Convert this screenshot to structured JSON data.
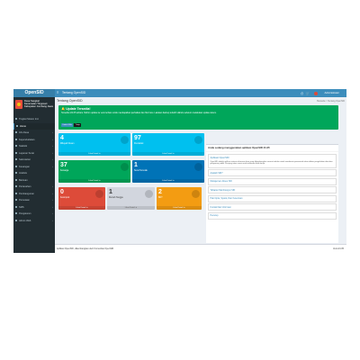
{
  "app": {
    "brand": "OpenSID"
  },
  "header": {
    "title": "Tentang OpenSID",
    "user": "Administrator",
    "breadcrumb": [
      "Beranda",
      "Tentang OpenSID"
    ]
  },
  "page": {
    "heading": "Tentang OpenSID"
  },
  "sidebar": {
    "village_name": "Desa Sangkal\nKecamatan Tlogosari\nKabupaten Jombang Jawa",
    "items": [
      {
        "label": "Tingkat Sistem Ind.",
        "chevron": false
      },
      {
        "label": "Home",
        "chevron": false,
        "active": true
      },
      {
        "label": "Info Desa",
        "chevron": true
      },
      {
        "label": "Kependudukan",
        "chevron": true
      },
      {
        "label": "Statistik",
        "chevron": true
      },
      {
        "label": "Layanan Surat",
        "chevron": true
      },
      {
        "label": "Sekretariat",
        "chevron": true
      },
      {
        "label": "Keuangan",
        "chevron": true
      },
      {
        "label": "Analisis",
        "chevron": false
      },
      {
        "label": "Bantuan",
        "chevron": false
      },
      {
        "label": "Pertanahan",
        "chevron": true
      },
      {
        "label": "Pembangunan",
        "chevron": true
      },
      {
        "label": "Pemetaan",
        "chevron": true
      },
      {
        "label": "SMS",
        "chevron": true
      },
      {
        "label": "Pengaturan",
        "chevron": true
      },
      {
        "label": "Admin Web",
        "chevron": true
      }
    ]
  },
  "alert": {
    "title": "Update Tersedia!",
    "body": "Tersedia v21.05 terbaru. Mohon update ke versi terbaru untuk mendapatkan perbaikan dan fitur baru. Lakukan backup terlebih dahulu sebelum melakukan update sistem.",
    "tag": "v21.05",
    "buttons": [
      {
        "label": "Unduh Rilis",
        "color": "#3c8dbc"
      },
      {
        "label": "Tutup",
        "color": "#1a1a1a"
      }
    ]
  },
  "stats": [
    {
      "value": "4",
      "label": "Wilayah Dusun",
      "link": "Lihat Detail",
      "color": "#00c0ef",
      "light": false
    },
    {
      "value": "97",
      "label": "Penduduk",
      "link": "Lihat Detail",
      "color": "#00c0ef",
      "light": false
    },
    {
      "value": "37",
      "label": "Keluarga",
      "link": "Lihat Detail",
      "color": "#00a65a",
      "light": false
    },
    {
      "value": "1",
      "label": "Surat Tercetak",
      "link": "Lihat Detail",
      "color": "#0073b7",
      "light": false
    },
    {
      "value": "0",
      "label": "Kelompok",
      "link": "Lihat Detail",
      "color": "#dd4b39",
      "light": false
    },
    {
      "value": "1",
      "label": "Rumah Tangga",
      "link": "Lihat Detail",
      "color": "#d2d6de",
      "light": true
    },
    {
      "value": "2",
      "label": "BDT",
      "link": "Lihat Detail",
      "color": "#f39c12",
      "light": false
    }
  ],
  "panel": {
    "title": "Anda sedang menggunakan aplikasi OpenSID 21.05",
    "card_title": "Aplikasi OpenSID",
    "card_text": "OpenSID adalah aplikasi sistem informasi desa yang dikembangkan secara terbuka untuk membantu pemerintah desa dalam pengelolaan data dan pelayanan publik. Kunjungi situs resmi untuk informasi lebih lanjut.",
    "links": [
      "Apakah SID?",
      "Manajemen Akses SID",
      "Tahapan Membangun SID",
      "Hak Cipta, Syarat, Dan Ketentuan",
      "Kontak Dan Informasi",
      "Penutup"
    ]
  },
  "footer": {
    "left": "Aplikasi OpenSID, dikembangkan oleh Komunitas OpenSID",
    "right": "Versi 21.05"
  }
}
